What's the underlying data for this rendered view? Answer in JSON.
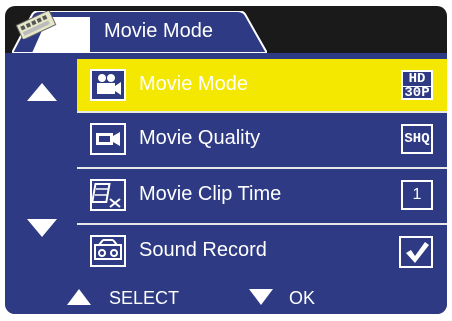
{
  "header": {
    "title": "Movie Mode",
    "icon": "memory-card-icon"
  },
  "menu": {
    "items": [
      {
        "label": "Movie Mode",
        "icon": "movie-camera-icon",
        "value_top": "HD",
        "value_bottom": "30P",
        "selected": true
      },
      {
        "label": "Movie Quality",
        "icon": "video-camera-icon",
        "value": "SHQ",
        "selected": false
      },
      {
        "label": "Movie Clip Time",
        "icon": "film-cut-icon",
        "value": "1",
        "selected": false
      },
      {
        "label": "Sound Record",
        "icon": "tape-recorder-icon",
        "value": "checked",
        "selected": false
      }
    ]
  },
  "footer": {
    "select_label": "SELECT",
    "ok_label": "OK"
  },
  "colors": {
    "panel": "#2e3b84",
    "selected": "#f5e800",
    "frame": "#1a1a1a"
  }
}
